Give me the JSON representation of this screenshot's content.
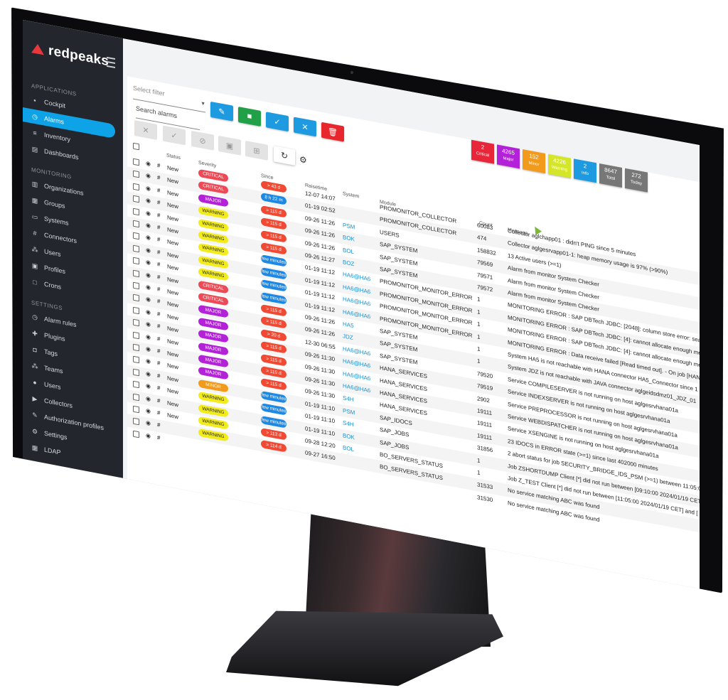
{
  "brand": {
    "name": "redpeaks"
  },
  "sidebar": {
    "sections": [
      {
        "title": "APPLICATIONS",
        "items": [
          {
            "label": "Cockpit",
            "icon": "cockpit-icon"
          },
          {
            "label": "Alarms",
            "icon": "alarm-clock-icon",
            "active": true
          },
          {
            "label": "Inventory",
            "icon": "inventory-icon"
          },
          {
            "label": "Dashboards",
            "icon": "dashboard-icon"
          }
        ]
      },
      {
        "title": "MONITORING",
        "items": [
          {
            "label": "Organizations",
            "icon": "organization-icon"
          },
          {
            "label": "Groups",
            "icon": "groups-icon"
          },
          {
            "label": "Systems",
            "icon": "systems-icon"
          },
          {
            "label": "Connectors",
            "icon": "connectors-icon"
          },
          {
            "label": "Users",
            "icon": "users-icon"
          },
          {
            "label": "Profiles",
            "icon": "profiles-icon"
          },
          {
            "label": "Crons",
            "icon": "crons-icon"
          }
        ]
      },
      {
        "title": "SETTINGS",
        "items": [
          {
            "label": "Alarm rules",
            "icon": "alarm-rules-icon"
          },
          {
            "label": "Plugins",
            "icon": "plugins-icon"
          },
          {
            "label": "Tags",
            "icon": "tags-icon"
          },
          {
            "label": "Teams",
            "icon": "teams-icon"
          },
          {
            "label": "Users",
            "icon": "user-icon"
          },
          {
            "label": "Collectors",
            "icon": "collectors-icon"
          },
          {
            "label": "Authorization profiles",
            "icon": "authorization-icon"
          },
          {
            "label": "Settings",
            "icon": "gear-icon"
          },
          {
            "label": "LDAP",
            "icon": "ldap-icon"
          }
        ]
      }
    ]
  },
  "toolbar": {
    "filter_placeholder": "Select filter",
    "search_label": "Search alarms",
    "buttons": [
      {
        "name": "edit-filter-button",
        "glyph": "✎",
        "color": "#1e9be0"
      },
      {
        "name": "save-filter-button",
        "glyph": "■",
        "color": "#22a047"
      },
      {
        "name": "apply-filter-button",
        "glyph": "✓",
        "color": "#1e9be0"
      },
      {
        "name": "clear-filter-button",
        "glyph": "✕",
        "color": "#1e9be0"
      },
      {
        "name": "delete-filter-button",
        "glyph": "🗑",
        "color": "#e8262d"
      }
    ]
  },
  "counters": [
    {
      "value": "2",
      "label": "Critical",
      "color": "#e8263a"
    },
    {
      "value": "4265",
      "label": "Major",
      "color": "#b322d8"
    },
    {
      "value": "152",
      "label": "Minor",
      "color": "#f29a1c"
    },
    {
      "value": "4226",
      "label": "Warning",
      "color": "#d5e62a"
    },
    {
      "value": "2",
      "label": "Info",
      "color": "#1e9be0"
    },
    {
      "value": "8647",
      "label": "Total",
      "color": "#777777"
    },
    {
      "value": "272",
      "label": "Today",
      "color": "#777777"
    }
  ],
  "table": {
    "columns": {
      "status": "Status",
      "severity": "Severity",
      "since": "Since",
      "raisetime": "Raisetime",
      "system": "System",
      "module": "Module",
      "count": "Count",
      "message": "Message"
    },
    "severity_colors": {
      "CRITICAL": "#ec4a56",
      "MAJOR": "#b322d8",
      "WARNING": "#f2ec1c",
      "MINOR": "#f29a1c"
    },
    "since_colors": {
      "long": "#f04a34",
      "short": "#1e88e5"
    },
    "rows": [
      {
        "status": "New",
        "severity": "CRITICAL",
        "since": "> 43 d",
        "since_kind": "long",
        "raisetime": "12-07 14:07",
        "system": "",
        "module": "PROMONITOR_COLLECTOR",
        "count": "60083",
        "message": "Collector aglchapp01 : didn't PING since 5 minutes"
      },
      {
        "status": "New",
        "severity": "CRITICAL",
        "since": "8 h 22 m",
        "since_kind": "short",
        "raisetime": "01-19 02:52",
        "system": "",
        "module": "PROMONITOR_COLLECTOR",
        "count": "474",
        "message": "Collector aglgesrvapp01-1: heap memory usage is 97% (>90%)"
      },
      {
        "status": "New",
        "severity": "MAJOR",
        "since": "> 115 d",
        "since_kind": "long",
        "raisetime": "09-26 11:26",
        "system": "PSM",
        "module": "USERS",
        "count": "158832",
        "message": "13 Active users (>=1)"
      },
      {
        "status": "New",
        "severity": "WARNING",
        "since": "> 115 d",
        "since_kind": "long",
        "raisetime": "09-26 11:26",
        "system": "BOK",
        "module": "SAP_SYSTEM",
        "count": "79569",
        "message": "Alarm from monitor System Checker"
      },
      {
        "status": "New",
        "severity": "WARNING",
        "since": "> 115 d",
        "since_kind": "long",
        "raisetime": "09-26 11:26",
        "system": "BOL",
        "module": "SAP_SYSTEM",
        "count": "79571",
        "message": "Alarm from monitor System Checker"
      },
      {
        "status": "New",
        "severity": "WARNING",
        "since": "> 115 d",
        "since_kind": "long",
        "raisetime": "09-26 11:27",
        "system": "BOZ",
        "module": "SAP_SYSTEM",
        "count": "79572",
        "message": "Alarm from monitor System Checker"
      },
      {
        "status": "New",
        "severity": "WARNING",
        "since": "few minutes",
        "since_kind": "short",
        "raisetime": "01-19 11:12",
        "system": "HA6@HA6",
        "module": "PROMONITOR_MONITOR_ERROR",
        "count": "1",
        "message": "MONITORING ERROR : SAP DBTech JDBC: [2048]: column store error: search"
      },
      {
        "status": "New",
        "severity": "WARNING",
        "since": "few minutes",
        "since_kind": "short",
        "raisetime": "01-19 11:12",
        "system": "HA6@HA6",
        "module": "PROMONITOR_MONITOR_ERROR",
        "count": "1",
        "message": "MONITORING ERROR : SAP DBTech JDBC: [4]: cannot allocate enough memory"
      },
      {
        "status": "New",
        "severity": "WARNING",
        "since": "few minutes",
        "since_kind": "short",
        "raisetime": "01-19 11:12",
        "system": "HA6@HA6",
        "module": "PROMONITOR_MONITOR_ERROR",
        "count": "1",
        "message": "MONITORING ERROR : SAP DBTech JDBC: [4]: cannot allocate enough memory"
      },
      {
        "status": "New",
        "severity": "CRITICAL",
        "since": "few minutes",
        "since_kind": "short",
        "raisetime": "01-19 11:12",
        "system": "HA6@HA6",
        "module": "PROMONITOR_MONITOR_ERROR",
        "count": "1",
        "message": "MONITORING ERROR : Data receive failed [Read timed out]. - On job [HANA"
      },
      {
        "status": "New",
        "severity": "CRITICAL",
        "since": "> 115 d",
        "since_kind": "long",
        "raisetime": "09-26 11:26",
        "system": "HA5",
        "module": "SAP_SYSTEM",
        "count": "1",
        "message": "System HA5 is not reachable with HANA connector HA5_Connector since 1"
      },
      {
        "status": "New",
        "severity": "MAJOR",
        "since": "> 115 d",
        "since_kind": "long",
        "raisetime": "09-26 11:26",
        "system": "JDZ",
        "module": "SAP_SYSTEM",
        "count": "1",
        "message": "System JDZ is not reachable with JAVA connector aglgeidsdmz01_JDZ_01"
      },
      {
        "status": "New",
        "severity": "MAJOR",
        "since": "> 20 d",
        "since_kind": "long",
        "raisetime": "12-30 06:55",
        "system": "HA6@HA6",
        "module": "SAP_SYSTEM",
        "count": "79520",
        "message": "Service COMPILESERVER is not running on host aglgesrvhana01a"
      },
      {
        "status": "New",
        "severity": "MAJOR",
        "since": "> 115 d",
        "since_kind": "long",
        "raisetime": "09-26 11:30",
        "system": "HA6@HA6",
        "module": "HANA_SERVICES",
        "count": "79519",
        "message": "Service INDEXSERVER is not running on host aglgesrvhana01a"
      },
      {
        "status": "New",
        "severity": "MAJOR",
        "since": "> 115 d",
        "since_kind": "long",
        "raisetime": "09-26 11:30",
        "system": "HA6@HA6",
        "module": "HANA_SERVICES",
        "count": "2902",
        "message": "Service PREPROCESSOR is not running on host aglgesrvhana01a"
      },
      {
        "status": "New",
        "severity": "MAJOR",
        "since": "> 115 d",
        "since_kind": "long",
        "raisetime": "09-26 11:30",
        "system": "HA6@HA6",
        "module": "HANA_SERVICES",
        "count": "19111",
        "message": "Service WEBDISPATCHER is not running on host aglgesrvhana01a"
      },
      {
        "status": "New",
        "severity": "MAJOR",
        "since": "> 115 d",
        "since_kind": "long",
        "raisetime": "09-26 11:30",
        "system": "S4H",
        "module": "HANA_SERVICES",
        "count": "19111",
        "message": "Service XSENGINE is not running on host aglgesrvhana01a"
      },
      {
        "status": "New",
        "severity": "MINOR",
        "since": "few minutes",
        "since_kind": "short",
        "raisetime": "01-19 11:10",
        "system": "PSM",
        "module": "SAP_IDOCS",
        "count": "19111",
        "message": "23 IDOCS in ERROR state (>=1) since last 402000 minutes"
      },
      {
        "status": "New",
        "severity": "WARNING",
        "since": "few minutes",
        "since_kind": "short",
        "raisetime": "01-19 11:10",
        "system": "S4H",
        "module": "SAP_JOBS",
        "count": "31856",
        "message": "2 abort status for job SECURITY_BRIDGE_IDS_PSM (>=1) between 11:05:00"
      },
      {
        "status": "New",
        "severity": "WARNING",
        "since": "few minutes",
        "since_kind": "short",
        "raisetime": "01-19 11:10",
        "system": "BOK",
        "module": "SAP_JOBS",
        "count": "1",
        "message": "Job ZSHORTDUMP Client [*] did not run between [09:10:00 2024/01/19 CET]"
      },
      {
        "status": "New",
        "severity": "WARNING",
        "since": "> 113 d",
        "since_kind": "long",
        "raisetime": "09-28 12:20",
        "system": "BOL",
        "module": "BO_SERVERS_STATUS",
        "count": "1",
        "message": "Job Z_TEST Client [*] did not run between [11:05:00 2024/01/19 CET] and ["
      },
      {
        "status": "",
        "severity": "WARNING",
        "since": "> 114 d",
        "since_kind": "long",
        "raisetime": "09-27 16:50",
        "system": "",
        "module": "BO_SERVERS_STATUS",
        "count": "31533",
        "message": "No service matching ABC was found"
      },
      {
        "status": "",
        "severity": "",
        "since": "",
        "since_kind": "long",
        "raisetime": "",
        "system": "",
        "module": "",
        "count": "31530",
        "message": "No service matching ABC was found"
      }
    ]
  }
}
